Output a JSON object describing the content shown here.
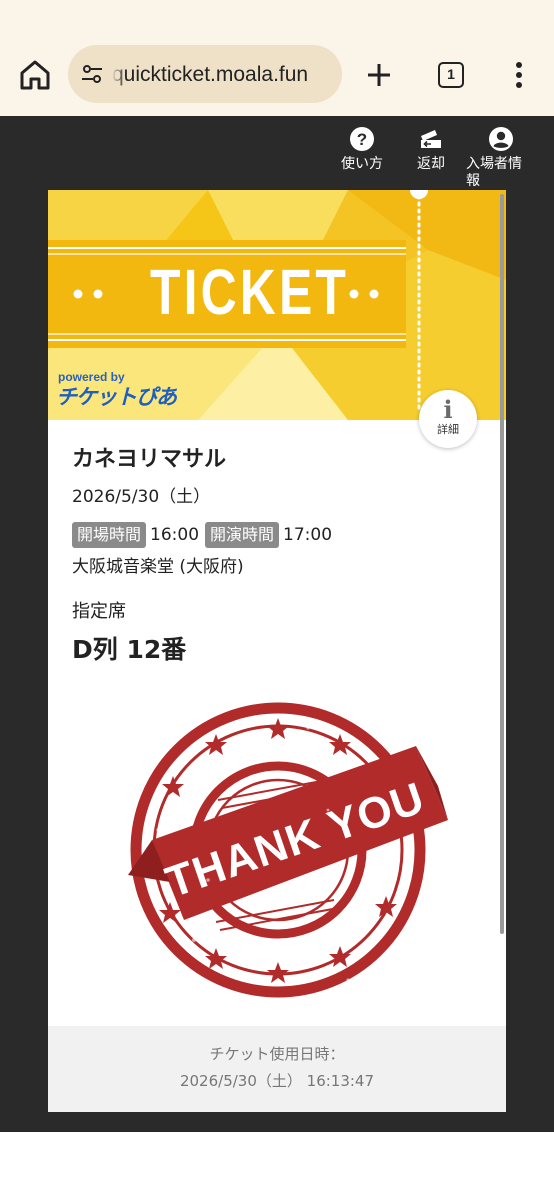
{
  "browser": {
    "url": "quickticket.moala.fun",
    "tab_count": "1"
  },
  "topnav": {
    "help_label": "使い方",
    "return_label": "返却",
    "visitor_info_label_line1": "入場者情",
    "visitor_info_label_line2": "報"
  },
  "ticket": {
    "banner_title": "TICKET",
    "powered_by": "powered by",
    "brand_logo_text": "チケットぴあ",
    "detail_label": "詳細",
    "artist": "カネヨリマサル",
    "date": "2026/5/30（土）",
    "open_label": "開場時間",
    "open_time": "16:00",
    "start_label": "開演時間",
    "start_time": "17:00",
    "venue": "大阪城音楽堂 (大阪府)",
    "seat_type": "指定席",
    "seat": "D列 12番",
    "stamp_text": "THANK YOU",
    "used_label": "チケット使用日時：",
    "used_at": "2026/5/30（土） 16:13:47"
  },
  "colors": {
    "banner_yellow": "#f5c518",
    "stamp_red": "#b22b2b",
    "brand_blue": "#1f5fbf",
    "badge_gray": "#8a8a8a"
  }
}
